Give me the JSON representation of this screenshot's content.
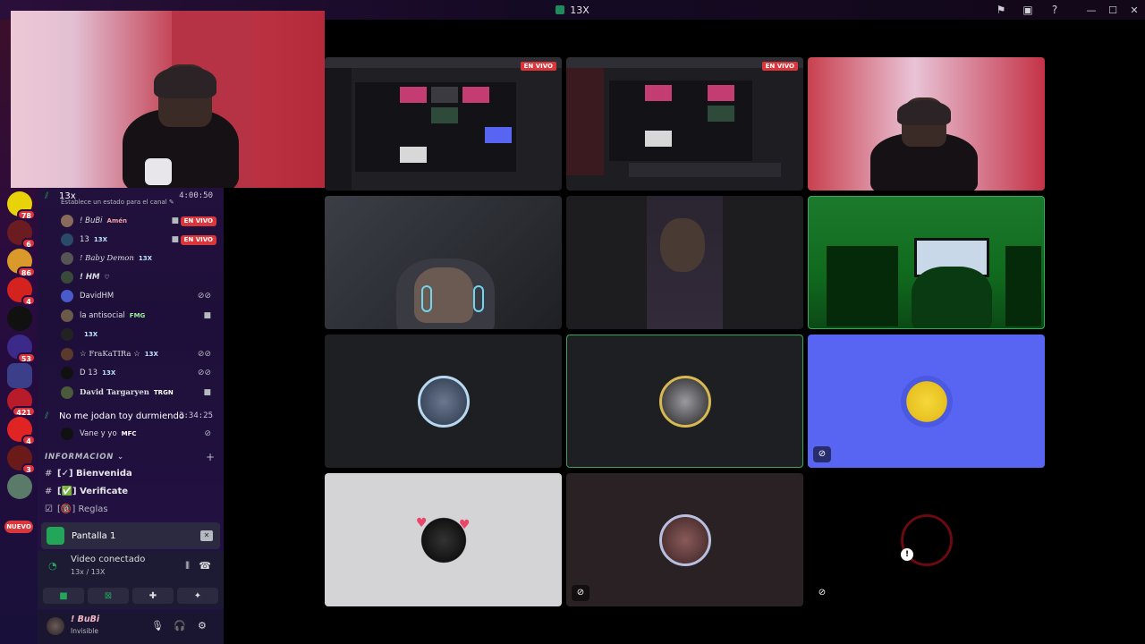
{
  "titlebar": {
    "title": "13X"
  },
  "servers": [
    {
      "badge": "78"
    },
    {
      "badge": "6"
    },
    {
      "badge": "86"
    },
    {
      "badge": "4"
    },
    {
      "badge": ""
    },
    {
      "badge": "53"
    },
    {
      "badge": ""
    },
    {
      "badge": "421"
    },
    {
      "badge": "4"
    },
    {
      "badge": "3"
    },
    {
      "badge": ""
    }
  ],
  "server_new_label": "NUEVO",
  "voice_channel_1": {
    "name": "13x",
    "time": "4:00:50",
    "status": "Establece un estado para el canal",
    "users": [
      {
        "name": "! BuBi",
        "tag": "Amén",
        "live": "EN VIVO"
      },
      {
        "name": "13",
        "tag": "13X",
        "live": "EN VIVO"
      },
      {
        "name": "! Baby Demon",
        "tag": "13X"
      },
      {
        "name": "! HM",
        "tag": ""
      },
      {
        "name": "DavidHM",
        "tag": ""
      },
      {
        "name": "la antisocial",
        "tag": "FMG"
      },
      {
        "name": "",
        "tag": "13X"
      },
      {
        "name": "☆ FraKaTIRa ☆",
        "tag": "13X"
      },
      {
        "name": "D 13",
        "tag": "13X"
      },
      {
        "name": "David Targaryen",
        "tag": "TRGN"
      }
    ]
  },
  "voice_channel_2": {
    "name": "No me jodan toy durmiendo",
    "time": "3:34:25",
    "users": [
      {
        "name": "Vane y yo",
        "tag": "MFC"
      }
    ]
  },
  "section": {
    "label": "INFORMACION"
  },
  "text_channels": [
    {
      "name": "Bienvenida",
      "emoji": "[✓]"
    },
    {
      "name": "Verificate",
      "emoji": "[✅]"
    },
    {
      "name": "Reglas",
      "emoji": "[🔞]"
    }
  ],
  "screen_share": {
    "label": "Pantalla 1"
  },
  "voice_status": {
    "title": "Video conectado",
    "subtitle": "13x / 13X"
  },
  "user_panel": {
    "name": "! BuBi",
    "status": "Invisible"
  },
  "grid": {
    "live_label": "EN VIVO"
  },
  "colors": {
    "accent_green": "#23a55a",
    "live_red": "#da373c",
    "blurple": "#5865f2"
  }
}
